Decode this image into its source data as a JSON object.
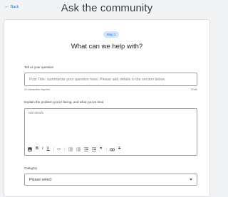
{
  "header": {
    "back_label": "Back",
    "title": "Ask the community"
  },
  "form": {
    "step_label": "Step 1",
    "heading": "What can we help with?",
    "question": {
      "label": "Tell us your question",
      "placeholder": "Post Title: summarize your question here. Please add details in the section below.",
      "helper_left": "10 characters required",
      "helper_right": "0/180"
    },
    "details": {
      "label": "Explain the problem you're facing, and what you've tried",
      "placeholder": "Add details",
      "toolbar": [
        {
          "name": "image-icon"
        },
        {
          "name": "bold-icon",
          "glyph": "B"
        },
        {
          "name": "italic-icon",
          "glyph": "I"
        },
        {
          "name": "underline-icon",
          "glyph": "U"
        },
        {
          "name": "code-icon",
          "glyph": "<>"
        },
        {
          "name": "bullet-list-icon"
        },
        {
          "name": "numbered-list-icon"
        },
        {
          "name": "indent-decrease-icon"
        },
        {
          "name": "indent-increase-icon"
        },
        {
          "name": "quote-icon",
          "glyph": "❞"
        },
        {
          "name": "link-icon"
        },
        {
          "name": "clear-format-icon",
          "glyph": "T"
        }
      ]
    },
    "category": {
      "label": "Category",
      "selected": "Please select"
    }
  }
}
